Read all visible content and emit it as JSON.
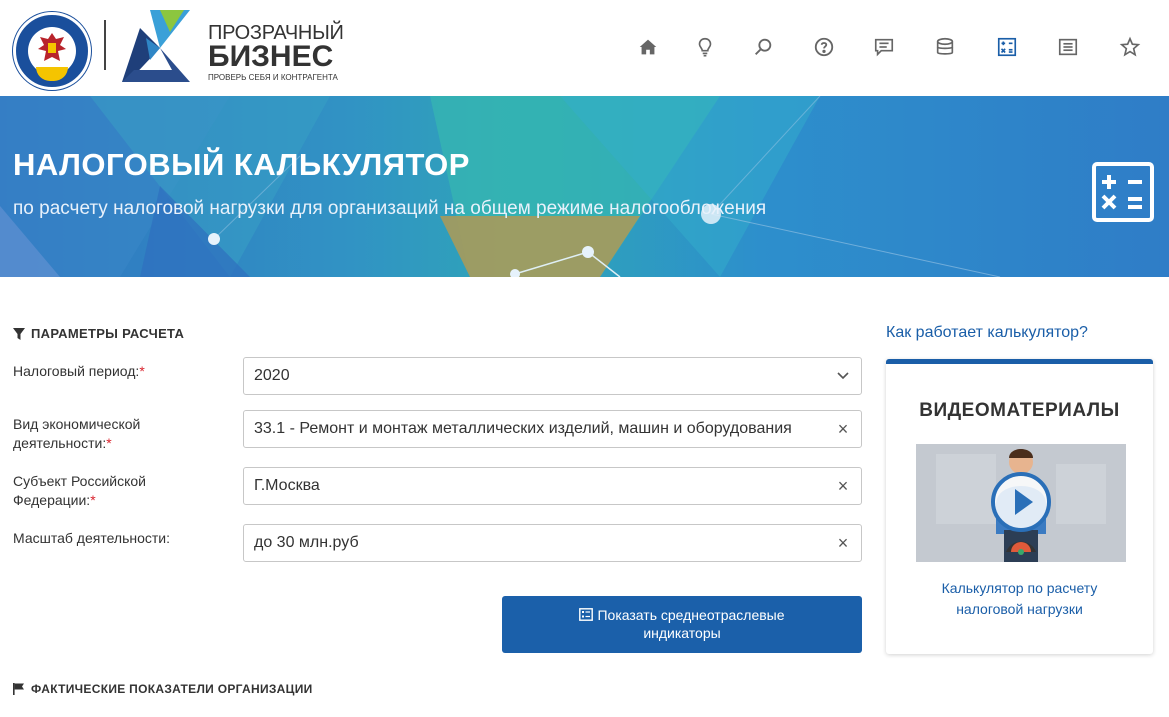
{
  "header": {
    "emblem_text": "ФЕДЕРАЛЬНАЯ НАЛОГОВАЯ СЛУЖБА",
    "brand_line1": "ПРОЗРАЧНЫЙ",
    "brand_line2": "БИЗНЕС",
    "brand_tagline": "ПРОВЕРЬ СЕБЯ И КОНТРАГЕНТА",
    "nav": [
      {
        "icon": "home-icon"
      },
      {
        "icon": "lightbulb-icon"
      },
      {
        "icon": "search-icon"
      },
      {
        "icon": "help-icon"
      },
      {
        "icon": "chat-icon"
      },
      {
        "icon": "database-icon"
      },
      {
        "icon": "calculator-icon",
        "active": true
      },
      {
        "icon": "list-icon"
      },
      {
        "icon": "star-icon"
      }
    ]
  },
  "banner": {
    "title": "НАЛОГОВЫЙ КАЛЬКУЛЯТОР",
    "subtitle": "по расчету налоговой нагрузки для организаций на общем режиме налогообложения"
  },
  "params": {
    "title": "ПАРАМЕТРЫ РАСЧЕТА",
    "period_label": "Налоговый период:",
    "period_value": "2020",
    "activity_label": "Вид экономической деятельности:",
    "activity_value": "33.1 - Ремонт и монтаж металлических изделий, машин и оборудования",
    "region_label": "Субъект Российской Федерации:",
    "region_value": "Г.Москва",
    "scale_label": "Масштаб деятельности:",
    "scale_value": "до 30 млн.руб",
    "required_mark": "*",
    "show_button_line1": "Показать среднеотраслевые",
    "show_button_line2": "индикаторы"
  },
  "facts": {
    "title": "ФАКТИЧЕСКИЕ ПОКАЗАТЕЛИ ОРГАНИЗАЦИИ"
  },
  "sidebar": {
    "how_link": "Как работает калькулятор?",
    "video_title": "ВИДЕОМАТЕРИАЛЫ",
    "video_caption_line1": "Калькулятор по расчету",
    "video_caption_line2": "налоговой нагрузки"
  },
  "colors": {
    "accent": "#1b60aa",
    "required": "#d9232d"
  }
}
